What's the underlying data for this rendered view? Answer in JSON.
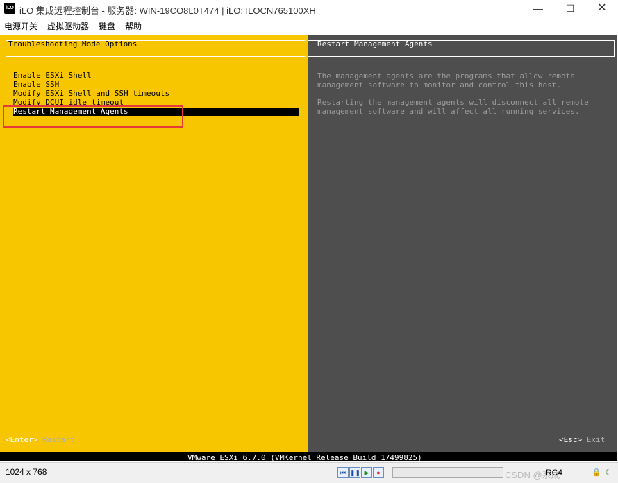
{
  "window": {
    "logo": "iLO",
    "title": "iLO 集成远程控制台 - 服务器: WIN-19CO8L0T474 | iLO: ILOCN765100XH",
    "minimize_icon": "minimize-icon",
    "maximize_icon": "maximize-icon",
    "close_icon": "close-icon"
  },
  "menu": {
    "items": [
      "电源开关",
      "虚拟驱动器",
      "键盘",
      "帮助"
    ]
  },
  "console": {
    "left_title": "Troubleshooting Mode Options",
    "options": [
      "Enable ESXi Shell",
      "Enable SSH",
      "Modify ESXi Shell and SSH timeouts",
      "Modify DCUI idle timeout",
      "Restart Management Agents"
    ],
    "selected_index": 4,
    "right_title": "Restart Management Agents",
    "desc1_line1": "The management agents are the programs that allow remote",
    "desc1_line2": "management software to monitor and control this host.",
    "desc2_line1": "Restarting the management agents will disconnect all remote",
    "desc2_line2": "management software and will affect all running services.",
    "enter_key": "<Enter>",
    "enter_action": "Restart",
    "esc_key": "<Esc>",
    "esc_action": "Exit",
    "status": "VMware ESXi 6.7.0 (VMKernel Release Build 17499825)"
  },
  "bottom": {
    "resolution": "1024 x 768",
    "watermark": "CSDN @系成",
    "rc_label": "RC4",
    "progress": 0
  },
  "colors": {
    "esxi_yellow": "#f7c600",
    "esxi_gray": "#4e4e4e",
    "highlight_red": "#e63a3a"
  }
}
